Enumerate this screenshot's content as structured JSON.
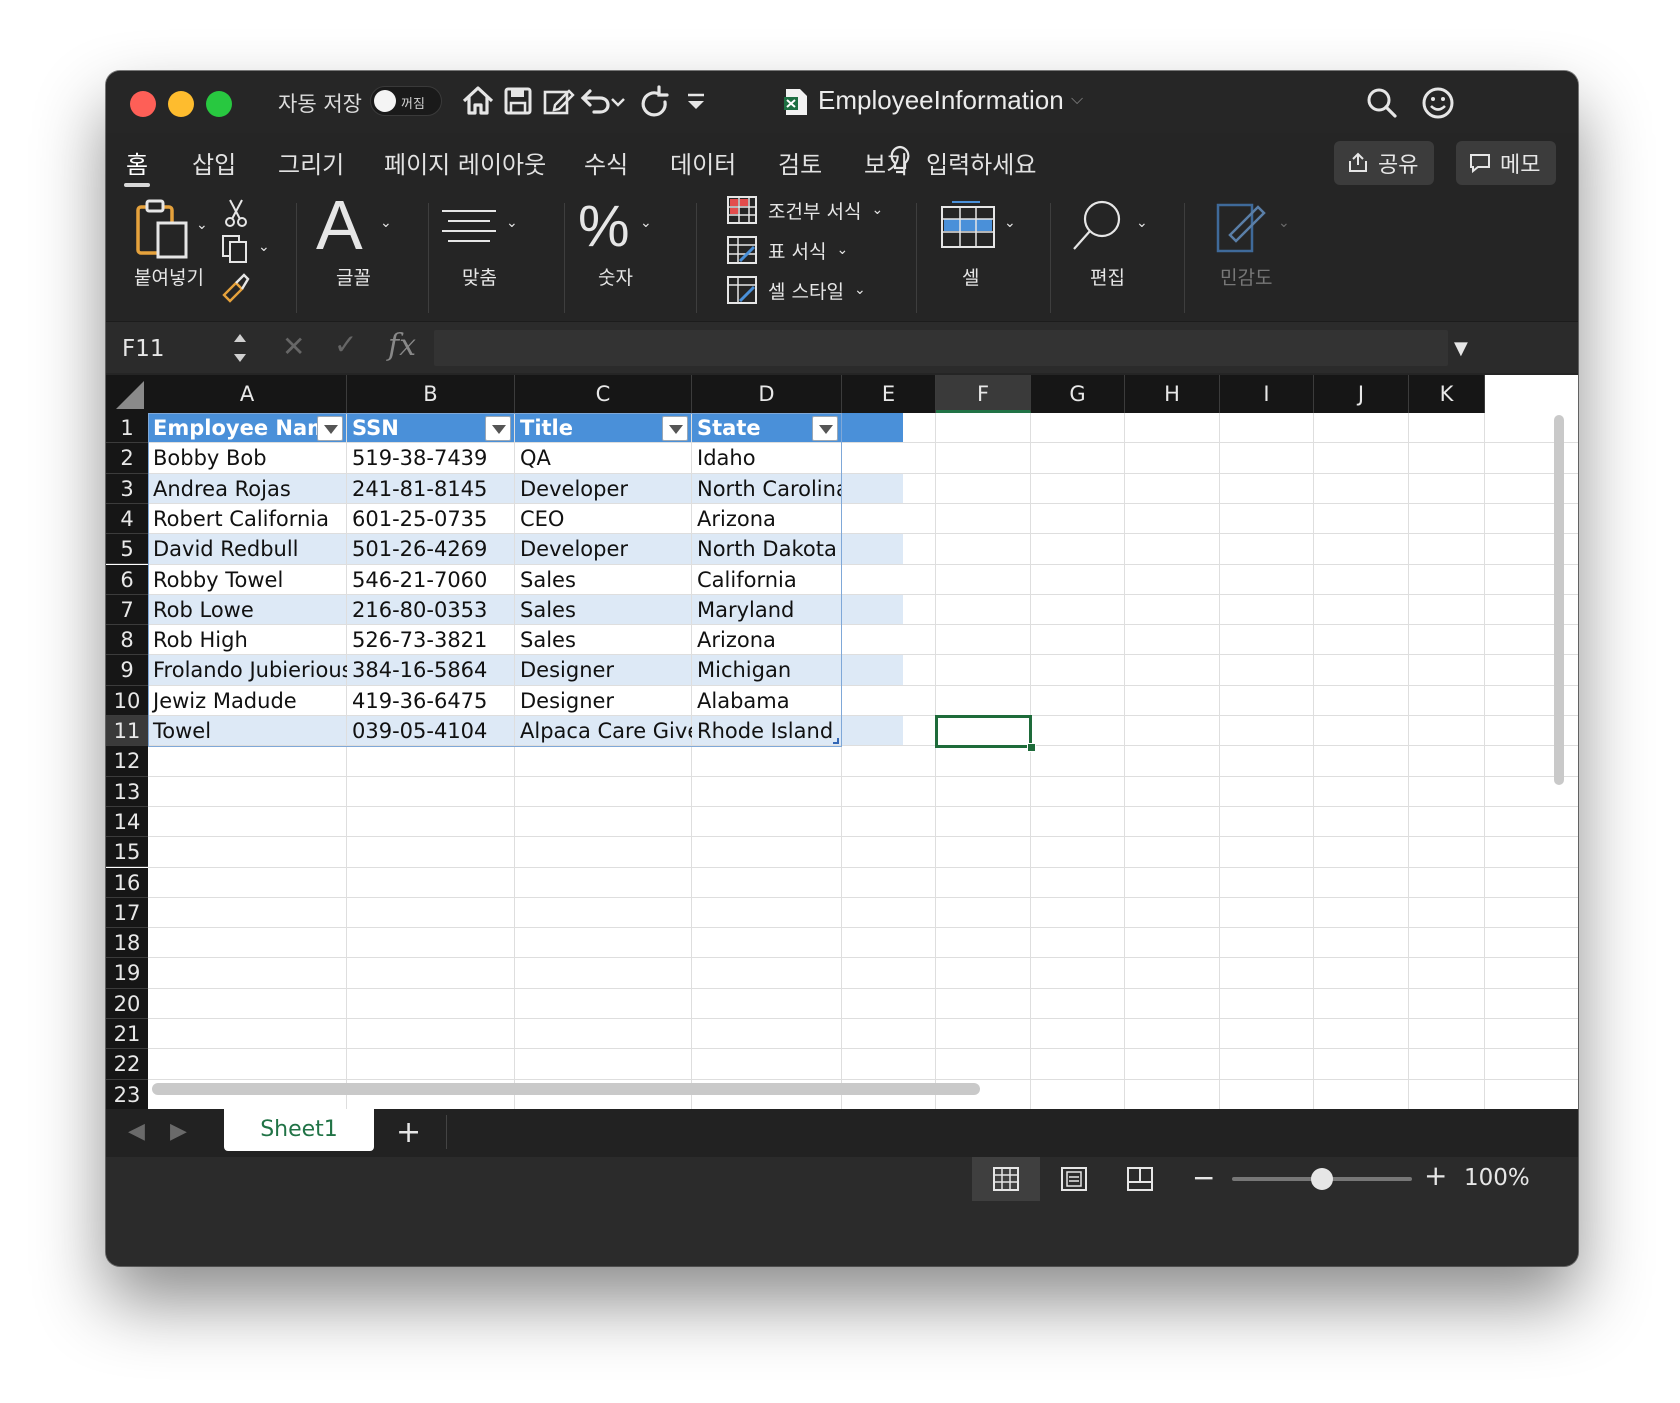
{
  "titlebar": {
    "autosave_label": "자동 저장",
    "autosave_state": "꺼짐",
    "document_title": "EmployeeInformation",
    "quick_access_icons": [
      "home-icon",
      "save-icon",
      "edit-icon",
      "undo-icon",
      "redo-icon",
      "customize-icon"
    ],
    "right_icons": [
      "search-icon",
      "smiley-icon"
    ]
  },
  "ribbon_tabs": {
    "tabs": [
      "홈",
      "삽입",
      "그리기",
      "페이지 레이아웃",
      "수식",
      "데이터",
      "검토",
      "보기"
    ],
    "active_tab": "홈",
    "tell_me": "입력하세요",
    "share_label": "공유",
    "comments_label": "메모"
  },
  "ribbon": {
    "paste_label": "붙여넣기",
    "font_label": "글꼴",
    "alignment_label": "맞춤",
    "number_label": "숫자",
    "conditional_format": "조건부 서식",
    "format_as_table": "표 서식",
    "cell_styles": "셀 스타일",
    "cells_label": "셀",
    "editing_label": "편집",
    "sensitivity_label": "민감도"
  },
  "formula_bar": {
    "name_box": "F11",
    "fx_label": "fx",
    "formula": ""
  },
  "grid": {
    "columns": [
      "A",
      "B",
      "C",
      "D",
      "E",
      "F",
      "G",
      "H",
      "I",
      "J",
      "K"
    ],
    "selected_column": "F",
    "rows": [
      "1",
      "2",
      "3",
      "4",
      "5",
      "6",
      "7",
      "8",
      "9",
      "10",
      "11",
      "12",
      "13",
      "14",
      "15",
      "16",
      "17",
      "18",
      "19",
      "20",
      "21",
      "22",
      "23"
    ],
    "selected_row": "11",
    "table_headers": [
      "Employee Name",
      "SSN",
      "Title",
      "State"
    ],
    "table_rows": [
      [
        "Bobby Bob",
        "519-38-7439",
        "QA",
        "Idaho"
      ],
      [
        "Andrea Rojas",
        "241-81-8145",
        "Developer",
        "North Carolina"
      ],
      [
        "Robert California",
        "601-25-0735",
        "CEO",
        "Arizona"
      ],
      [
        "David Redbull",
        "501-26-4269",
        "Developer",
        "North Dakota"
      ],
      [
        "Robby Towel",
        "546-21-7060",
        "Sales",
        "California"
      ],
      [
        "Rob Lowe",
        "216-80-0353",
        "Sales",
        "Maryland"
      ],
      [
        "Rob High",
        "526-73-3821",
        "Sales",
        "Arizona"
      ],
      [
        "Frolando Jubierious",
        "384-16-5864",
        "Designer",
        "Michigan"
      ],
      [
        "Jewiz Madude",
        "419-36-6475",
        "Designer",
        "Alabama"
      ],
      [
        "Towel",
        "039-05-4104",
        "Alpaca Care Giver",
        "Rhode Island"
      ]
    ]
  },
  "sheet_bar": {
    "sheets": [
      "Sheet1"
    ],
    "add_sheet": "+"
  },
  "status_bar": {
    "zoom": "100%",
    "zoom_level": 0.5
  },
  "colors": {
    "table_header": "#4a90d9",
    "table_band": "#dde9f6",
    "selection": "#1e6b3a"
  }
}
